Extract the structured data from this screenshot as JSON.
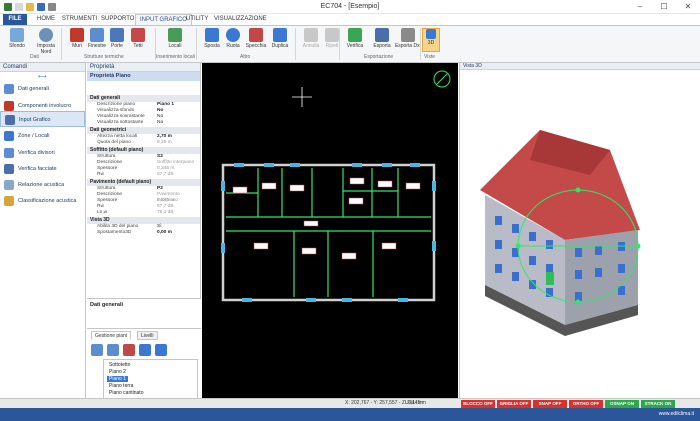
{
  "app": {
    "title": "EC704 - [Esempio]"
  },
  "ribbon_tabs": [
    "FILE",
    "HOME",
    "STRUMENTI",
    "SUPPORTO",
    "INPUT GRAFICO",
    "UTILITY",
    "VISUALIZZAZIONE"
  ],
  "ribbon": {
    "buttons": [
      {
        "label": "Sfondo",
        "icon": "background-icon"
      },
      {
        "label": "Imposta Nord",
        "icon": "compass-icon"
      },
      {
        "label": "Muri",
        "icon": "wall-icon"
      },
      {
        "label": "Finestre",
        "icon": "window-icon"
      },
      {
        "label": "Porte",
        "icon": "door-icon"
      },
      {
        "label": "Tetti",
        "icon": "roof-icon"
      },
      {
        "label": "Locali",
        "icon": "rooms-icon"
      },
      {
        "label": "Sposta",
        "icon": "move-icon"
      },
      {
        "label": "Ruota",
        "icon": "rotate-icon"
      },
      {
        "label": "Specchia",
        "icon": "mirror-icon"
      },
      {
        "label": "Duplica",
        "icon": "duplicate-icon"
      },
      {
        "label": "Annulla",
        "icon": "undo-icon"
      },
      {
        "label": "Ripeti",
        "icon": "redo-icon"
      },
      {
        "label": "Verifica",
        "icon": "verify-icon"
      },
      {
        "label": "Esporta",
        "icon": "export-icon"
      },
      {
        "label": "Esporta Dxf",
        "icon": "export-dxf-icon"
      },
      {
        "label": "3D",
        "icon": "3d-view-icon"
      }
    ],
    "groups": [
      "Dati",
      "Strutture termiche",
      "Inserimento locali",
      "Altro",
      "Esportazione",
      "Viste"
    ]
  },
  "commands": {
    "title": "Comandi",
    "items": [
      "Dati generali",
      "Componenti involucro",
      "Input Grafico",
      "Zone / Locali",
      "Verifica divisori",
      "Verifica facciate",
      "Relazione acustica",
      "Classificazione acustica"
    ]
  },
  "properties": {
    "title": "Proprietà",
    "subtitle": "Proprietà Piano",
    "sections": [
      {
        "name": "Dati generali",
        "rows": [
          [
            "Descrizione piano",
            "Piano 1"
          ],
          [
            "Visualizza sfondo",
            "No"
          ],
          [
            "Visualizza sovrastante",
            "No"
          ],
          [
            "Visualizza sottostante",
            "No"
          ]
        ]
      },
      {
        "name": "Dati geometrici",
        "rows": [
          [
            "Altezza netta locali",
            "2,70 m"
          ],
          [
            "Quota del piano",
            "6,15 m"
          ]
        ]
      },
      {
        "name": "Soffitto (default piano)",
        "rows": [
          [
            "Struttura",
            "S2"
          ],
          [
            "Descrizione",
            "Soffitto interpiano"
          ],
          [
            "Spessore",
            "0,345 m"
          ],
          [
            "Rw",
            "57,7 dB"
          ]
        ]
      },
      {
        "name": "Pavimento (default piano)",
        "rows": [
          [
            "Struttura",
            "P2"
          ],
          [
            "Descrizione",
            "Pavimento interpiano"
          ],
          [
            "Spessore",
            "0,345 m"
          ],
          [
            "Rw",
            "57,7 dB"
          ],
          [
            "Ln,w",
            "76,3 dB"
          ]
        ]
      },
      {
        "name": "Vista 3D",
        "rows": [
          [
            "Abilita 3D del piano",
            "Sì"
          ],
          [
            "Spostamento3D",
            "0,00 m"
          ]
        ]
      }
    ],
    "description_title": "Dati generali"
  },
  "floors": {
    "tabs": [
      "Gestione piani",
      "Livelli"
    ],
    "items": [
      "Sottotetto",
      "Piano 2",
      "Piano 1",
      "Piano terra",
      "Piano cantinato"
    ],
    "selected": "Piano 1"
  },
  "views": {
    "view3d_title": "Vista 3D"
  },
  "status": {
    "coords": "X: 202,767 - Y: 257,557 - Z: 6,145 m",
    "units": "U.M.: m",
    "toggles": [
      {
        "label": "BLOCCO OFF",
        "color": "#d9302c"
      },
      {
        "label": "GRIGLIA OFF",
        "color": "#d9302c"
      },
      {
        "label": "SNAP OFF",
        "color": "#d9302c"
      },
      {
        "label": "ORTHO OFF",
        "color": "#d9302c"
      },
      {
        "label": "OSNAP ON",
        "color": "#2aa84a"
      },
      {
        "label": "STRACK ON",
        "color": "#2aa84a"
      }
    ]
  },
  "footer": {
    "website": "www.edilclima.it"
  },
  "colors": {
    "accent": "#2b579a",
    "wall": "#2ee86a",
    "roof": "#c44a4a"
  }
}
